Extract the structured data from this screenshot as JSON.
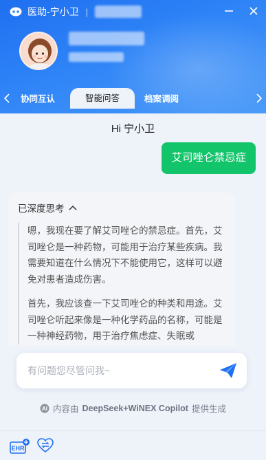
{
  "titlebar": {
    "app_title": "医助-宁小卫",
    "separator": "|"
  },
  "tabs": [
    {
      "label": "协同互认",
      "active": false
    },
    {
      "label": "智能问答",
      "active": true
    },
    {
      "label": "档案调阅",
      "active": false
    }
  ],
  "chat": {
    "greeting": "Hi 宁小卫",
    "user_message": "艾司唑仑禁忌症",
    "bot": {
      "think_title": "已深度思考",
      "paragraphs": [
        "嗯，我现在要了解艾司唑仑的禁忌症。首先，艾司唑仑是一种药物，可能用于治疗某些疾病。我需要知道在什么情况下不能使用它，这样可以避免对患者造成伤害。",
        "首先，我应该查一下艾司唑仑的种类和用途。艾司唑仑听起来像是一种化学药品的名称，可能是一种神经药物，用于治疗焦虑症、失眠或"
      ]
    }
  },
  "input": {
    "placeholder": "有问题您尽管问我~"
  },
  "footer": {
    "powered_prefix": "内容由",
    "powered_brand": "DeepSeek+WiNEX Copilot",
    "powered_suffix": "提供生成",
    "ehr_label": "EHR"
  },
  "colors": {
    "header_blue": "#2f84f7",
    "user_bubble": "#12c46a",
    "send_icon": "#1f6ff0"
  }
}
